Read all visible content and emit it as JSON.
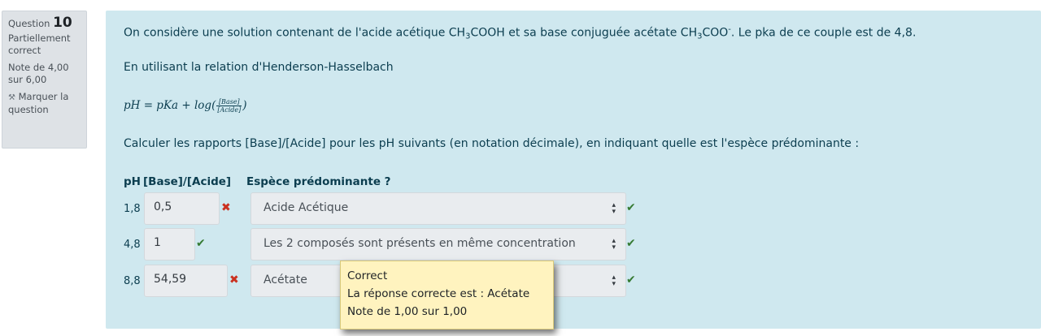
{
  "question_info": {
    "label": "Question",
    "number": "10",
    "state": "Partiellement correct",
    "grade": "Note de 4,00 sur 6,00",
    "flag_label": "Marquer la question"
  },
  "content": {
    "intro_part1": "On considère une solution contenant de l'acide acétique CH",
    "intro_sub1": "3",
    "intro_part2": "COOH et sa base conjuguée acétate CH",
    "intro_sub2": "3",
    "intro_part3": "COO",
    "intro_sup": "-",
    "intro_part4": ". Le pka de ce couple est de 4,8.",
    "relation": "En utilisant la relation d'Henderson-Hasselbach",
    "formula_left": "pH = pKa + log(",
    "formula_num": "[Base]",
    "formula_den": "[Acide]",
    "formula_right": ")",
    "instruction": "Calculer les rapports [Base]/[Acide] pour les pH suivants (en notation décimale), en indiquant quelle est l'espèce prédominante :"
  },
  "table": {
    "header_ph": "pH",
    "header_ratio": "[Base]/[Acide]",
    "header_species": "Espèce prédominante ?",
    "rows": [
      {
        "ph": "1,8",
        "ratio": "0,5",
        "species": "Acide Acétique"
      },
      {
        "ph": "4,8",
        "ratio": "1",
        "species": "Les 2 composés sont présents en même concentration"
      },
      {
        "ph": "8,8",
        "ratio": "54,59",
        "species": "Acétate"
      }
    ]
  },
  "tooltip": {
    "line1": "Correct",
    "line2": "La réponse correcte est : Acétate",
    "line3": "Note de 1,00 sur 1,00"
  },
  "colors": {
    "content_bg": "#cfe8ef",
    "incorrect": "#ca3120",
    "correct": "#357a32",
    "tooltip_bg": "#fff3bf"
  }
}
